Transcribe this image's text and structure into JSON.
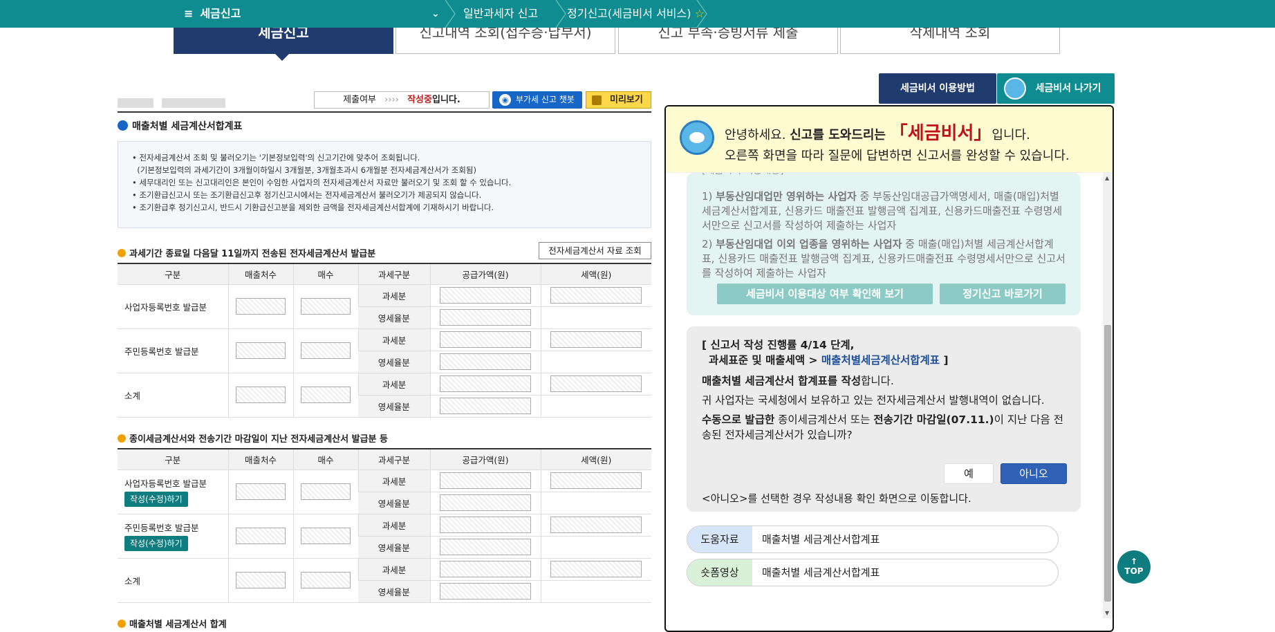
{
  "nav": {
    "menu_label": "세금신고",
    "crumb1": "일반과세자 신고",
    "crumb2": "정기신고(세금비서 서비스)"
  },
  "tabs": [
    "세금신고",
    "신고내역 조회(접수증·납부서)",
    "신고 부속·증빙서류 제출",
    "삭제내역 조회"
  ],
  "top_buttons": {
    "guide": "세금비서 이용방법",
    "exit": "세금비서 나가기"
  },
  "status": {
    "label": "제출여부",
    "arrows": "››››",
    "state": "작성중",
    "suffix": "입니다."
  },
  "chatbot_label": "부가세 신고 챗봇",
  "preview_label": "미리보기",
  "section_title": "매출처별 세금계산서합계표",
  "info_lines": [
    "• 전자세금계산서 조회 및 불러오기는 '기본정보입력'의 신고기간에 맞추어 조회됩니다.",
    "  (기본정보입력의 과세기간이 3개월이하일시 3개월분, 3개월초과시 6개월분 전자세금계산서가 조회됨)",
    "• 세무대리인 또는 신고대리인은 본인이 수임한 사업자의 전자세금계산서 자료만 불러오기 및 조회 할 수 있습니다.",
    "• 조기환급신고시 또는 조기환급신고후 정기신고시에서는 전자세금계산서 불러오기가 제공되지 않습니다.",
    "• 조기환급후 정기신고시, 반드시 기환급신고분을 제외한 금액을 전자세금계산서합계에 기재하시기 바랍니다."
  ],
  "sub1": "과세기간 종료일 다음달 11일까지 전송된 전자세금계산서 발급분",
  "lookup_label": "전자세금계산서 자료 조회",
  "sub2": "종이세금계산서와 전송기간 마감일이 지난 전자세금계산서 발급분 등",
  "sub3": "매출처별 세금계산서 합계",
  "table_headers": [
    "구분",
    "매출처수",
    "매수",
    "과세구분",
    "공급가액(원)",
    "세액(원)"
  ],
  "row_labels": [
    "사업자등록번호 발급분",
    "주민등록번호 발급분",
    "소계"
  ],
  "type_labels": [
    "과세분",
    "영세율분"
  ],
  "edit_label": "작성(수정)하기",
  "panel": {
    "greet_prefix": "안녕하세요. ",
    "greet_bold": "신고를 도와드리는",
    "brand": "「세금비서」",
    "greet_suffix": "입니다.",
    "greet_line2": "오른쪽 화면을 따라 질문에 답변하면 신고서를 완성할 수 있습니다.",
    "cut_label": "[세금비서 이용대상]",
    "item1_num": "1)",
    "item1_bold": "부동산임대업만 영위하는 사업자",
    "item1_rest": " 중 부동산임대공급가액명세서, 매출(매입)처별 세금계산서합계표, 신용카드 매출전표 발행금액 집계표, 신용카드매출전표 수령명세서만으로 신고서를 작성하여 제출하는 사업자",
    "item2_num": "2)",
    "item2_bold": "부동산임대업 이외 업종을 영위하는 사업자",
    "item2_rest": " 중 매출(매입)처별 세금계산서합계표, 신용카드 매출전표 발행금액 집계표, 신용카드매출전표 수령명세서만으로 신고서를 작성하여 제출하는 사업자",
    "check_btn": "세금비서 이용대상 여부 확인해 보기",
    "goto_btn": "정기신고 바로가기",
    "progress_line1": "[ 신고서 작성 진행률 4/14 단계,",
    "progress_line2_a": "과세표준 및 매출세액 > ",
    "progress_line2_b": "매출처별세금계산서합계표",
    "progress_line2_c": " ]",
    "q_bold": "매출처별 세금계산서 합계표를 작성",
    "q_suffix": "합니다.",
    "q2": "귀 사업자는 국세청에서 보유하고 있는 전자세금계산서 발행내역이 없습니다.",
    "q3_a": "수동으로 발급한",
    "q3_b": " 종이세금계산서 또는 ",
    "q3_c": "전송기간 마감일(07.11.)",
    "q3_d": "이 지난 다음 전송된 전자세금계산서",
    "q3_e": "가 있습니까?",
    "yes": "예",
    "no": "아니오",
    "note": "<아니오>를 선택한 경우 작성내용 확인 화면으로 이동합니다.",
    "help_label": "도움자료",
    "help_text": "매출처별 세금계산서합계표",
    "video_label": "숏폼영상",
    "video_text": "매출처별 세금계산서합계표"
  },
  "top_float": "TOP",
  "colors": {
    "teal": "#0e8c8f",
    "navy": "#203b6e",
    "brand_red": "#c0101a"
  }
}
